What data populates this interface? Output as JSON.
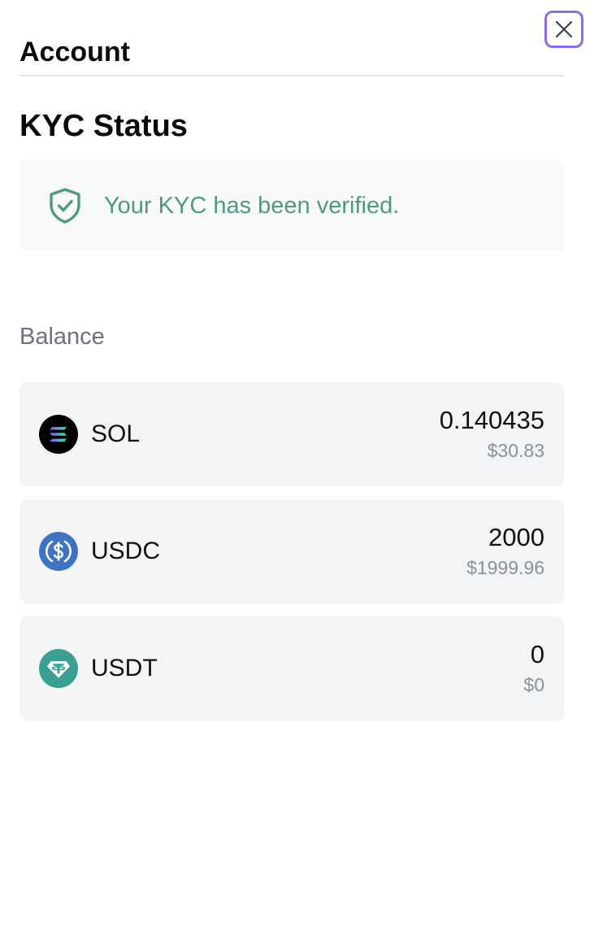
{
  "header": {
    "title": "Account"
  },
  "kyc": {
    "title": "KYC Status",
    "message": "Your KYC has been verified.",
    "status_color": "#4f9b78"
  },
  "balance": {
    "label": "Balance",
    "tokens": [
      {
        "symbol": "SOL",
        "amount": "0.140435",
        "usd": "$30.83",
        "icon": "solana-icon"
      },
      {
        "symbol": "USDC",
        "amount": "2000",
        "usd": "$1999.96",
        "icon": "usdc-icon"
      },
      {
        "symbol": "USDT",
        "amount": "0",
        "usd": "$0",
        "icon": "usdt-icon"
      }
    ]
  },
  "colors": {
    "accent": "#8b6cf0",
    "card_bg": "#f3f4f6",
    "usdc": "#3e73c4",
    "usdt": "#3a9f91"
  }
}
